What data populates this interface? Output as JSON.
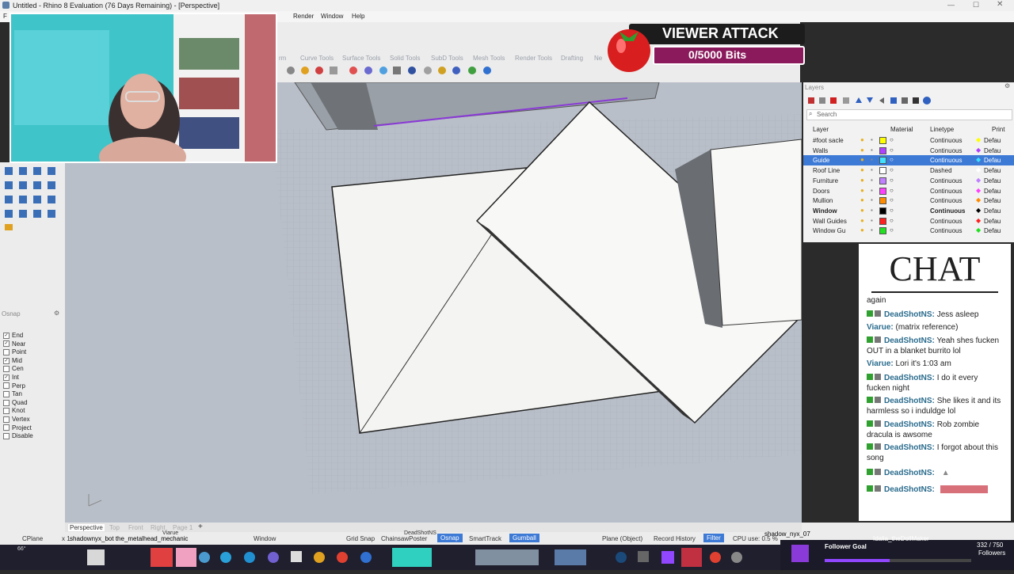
{
  "window": {
    "title": "Untitled - Rhino 8 Evaluation (76 Days Remaining) - [Perspective]"
  },
  "menu": {
    "items": [
      "F",
      "Render",
      "Window",
      "Help"
    ]
  },
  "ribbon": {
    "tabs": [
      "rm",
      "Curve Tools",
      "Surface Tools",
      "Solid Tools",
      "SubD Tools",
      "Mesh Tools",
      "Render Tools",
      "Drafting",
      "Ne"
    ]
  },
  "viewport": {
    "label": "Perspective"
  },
  "osnap": {
    "title": "Osnap",
    "items": [
      {
        "label": "End",
        "checked": true
      },
      {
        "label": "Near",
        "checked": true
      },
      {
        "label": "Point",
        "checked": false
      },
      {
        "label": "Mid",
        "checked": true
      },
      {
        "label": "Cen",
        "checked": false
      },
      {
        "label": "Int",
        "checked": true
      },
      {
        "label": "Perp",
        "checked": false
      },
      {
        "label": "Tan",
        "checked": false
      },
      {
        "label": "Quad",
        "checked": false
      },
      {
        "label": "Knot",
        "checked": false
      },
      {
        "label": "Vertex",
        "checked": false
      },
      {
        "label": "Project",
        "checked": false
      },
      {
        "label": "Disable",
        "checked": false
      }
    ]
  },
  "layers": {
    "title": "Layers",
    "search_placeholder": "Search",
    "columns": [
      "Layer",
      "Material",
      "Linetype",
      "Print"
    ],
    "rows": [
      {
        "name": "#foot sacle",
        "linetype": "Continuous",
        "print": "Defau",
        "color": "#ffff00"
      },
      {
        "name": "Walls",
        "linetype": "Continuous",
        "print": "Defau",
        "color": "#b040ff"
      },
      {
        "name": "Guide",
        "linetype": "Continuous",
        "print": "Defau",
        "color": "#40e0ff",
        "selected": true
      },
      {
        "name": "Roof Line",
        "linetype": "Dashed",
        "print": "Defau",
        "color": "#ffffff"
      },
      {
        "name": "Furniture",
        "linetype": "Continuous",
        "print": "Defau",
        "color": "#c080ff"
      },
      {
        "name": "Doors",
        "linetype": "Continuous",
        "print": "Defau",
        "color": "#ff40ff"
      },
      {
        "name": "Mullion",
        "linetype": "Continuous",
        "print": "Defau",
        "color": "#ff8c00"
      },
      {
        "name": "Window",
        "linetype": "Continuous",
        "print": "Defau",
        "color": "#000000",
        "bold": true
      },
      {
        "name": "Wall Guides",
        "linetype": "Continuous",
        "print": "Defau",
        "color": "#ff2020"
      },
      {
        "name": "Window Gu",
        "linetype": "Continuous",
        "print": "Defau",
        "color": "#20e020"
      }
    ]
  },
  "overlay": {
    "viewer_attack": "VIEWER ATTACK",
    "bits": "0/5000 Bits",
    "chat_title": "CHAT",
    "follower_goal": "Follower Goal",
    "follower_name": "Idalia_theDollMaker",
    "followers_count": "332 / 750",
    "followers_label": "Followers",
    "recent_follower": "shadow_nyx_07"
  },
  "chat": [
    {
      "user": "",
      "text": "again"
    },
    {
      "user": "DeadShotNS:",
      "text": "Jess asleep"
    },
    {
      "user": "Viarue:",
      "text": "(matrix reference)"
    },
    {
      "user": "DeadShotNS:",
      "text": "Yeah shes fucken OUT in a blanket burrito lol"
    },
    {
      "user": "Viarue:",
      "text": "Lori it's 1:03 am"
    },
    {
      "user": "DeadShotNS:",
      "text": "I do it every fucken night"
    },
    {
      "user": "DeadShotNS:",
      "text": "She likes it and its harmless so i induldge lol"
    },
    {
      "user": "DeadShotNS:",
      "text": "Rob zombie dracula is awsome"
    },
    {
      "user": "DeadShotNS:",
      "text": "I forgot about this song"
    },
    {
      "user": "DeadShotNS:",
      "text": ""
    },
    {
      "user": "DeadShotNS:",
      "text": ""
    }
  ],
  "status": {
    "cplane": "CPlane",
    "coords": "x 1",
    "viewport_tabs": [
      "Perspective",
      "Top",
      "Front",
      "Right",
      "Page 1"
    ],
    "items": [
      "Window",
      "Grid Snap",
      "ChainsawPoster",
      "Osnap",
      "SmartTrack",
      "Gumball",
      "Plane (Object)",
      "Record History",
      "Filter",
      "CPU use: 0.5 %"
    ],
    "ticker": "shadownyx_bot  the_metalhead_mechanic",
    "ticker2": "DeadShotNS",
    "ticker3": "Viarue"
  },
  "colors": {
    "accent": "#3d7ad6",
    "viewport": "#b9bfc9",
    "viewer_bar": "#8b1a5c"
  }
}
